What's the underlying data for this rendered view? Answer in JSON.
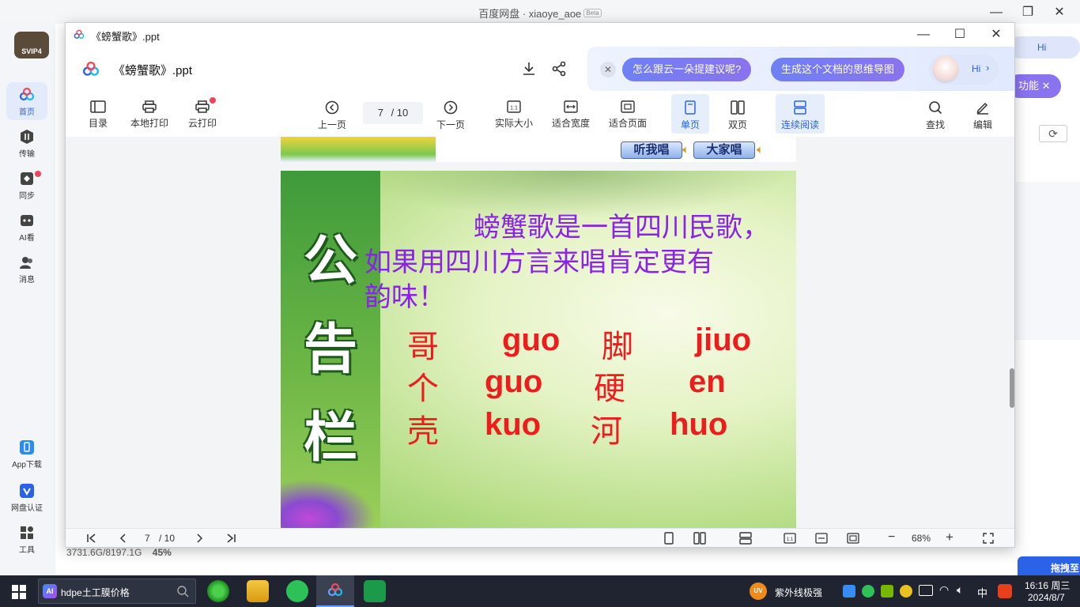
{
  "background_app": {
    "title": "百度网盘 · xiaoye_aoe",
    "beta": "Beta",
    "logo_text": "SVIP4",
    "nav": [
      {
        "label": "首页"
      },
      {
        "label": "传输"
      },
      {
        "label": "同步"
      },
      {
        "label": "AI看"
      },
      {
        "label": "消息"
      }
    ],
    "bottom_nav": [
      {
        "label": "App下载"
      },
      {
        "label": "网盘认证"
      },
      {
        "label": "工具"
      }
    ],
    "right_hi": "Hi",
    "right_feature": "功能",
    "drag_hint": "拖拽至"
  },
  "viewer": {
    "window_title": "《螃蟹歌》.ppt",
    "file_name": "《螃蟹歌》.ppt",
    "ai": {
      "chip1": "怎么跟云一朵提建议呢?",
      "chip2": "生成这个文档的思维导图",
      "hi": "Hi"
    },
    "toolbar": {
      "toc": "目录",
      "local_print": "本地打印",
      "cloud_print": "云打印",
      "prev": "上一页",
      "page_current": "7",
      "page_total": "/ 10",
      "next": "下一页",
      "actual_size": "实际大小",
      "fit_width": "适合宽度",
      "fit_page": "适合页面",
      "single": "单页",
      "double": "双页",
      "continuous": "连续阅读",
      "find": "查找",
      "edit": "编辑"
    },
    "prev_slide": {
      "btn_listen": "听我唱",
      "btn_sing": "大家唱"
    },
    "slide": {
      "board_chars": [
        "公",
        "告",
        "栏"
      ],
      "para_line1": "螃蟹歌是一首四川民歌，",
      "para_line2": "如果用四川方言来唱肯定更有",
      "para_line3": "韵味！",
      "rows": [
        [
          "哥",
          "guo",
          "脚",
          "jiuo"
        ],
        [
          "个",
          "guo",
          "硬",
          "en"
        ],
        [
          "壳",
          "kuo",
          "河",
          "huo"
        ]
      ]
    },
    "status": {
      "page_current": "7",
      "page_total": "/ 10",
      "zoom": "68%"
    }
  },
  "storage": {
    "used": "3731.6G/8197.1G",
    "percent": "45%"
  },
  "taskbar": {
    "search_text": "hdpe土工膜价格",
    "ai_badge": "AI",
    "uv_badge": "UV",
    "uv_label": "紫外线极强",
    "ime": "中",
    "time": "16:16 周三",
    "date": "2024/8/7"
  },
  "colors": {
    "accent": "#2a63e8",
    "slide_para": "#8a22e8",
    "slide_pinyin": "#ee1c1c"
  }
}
